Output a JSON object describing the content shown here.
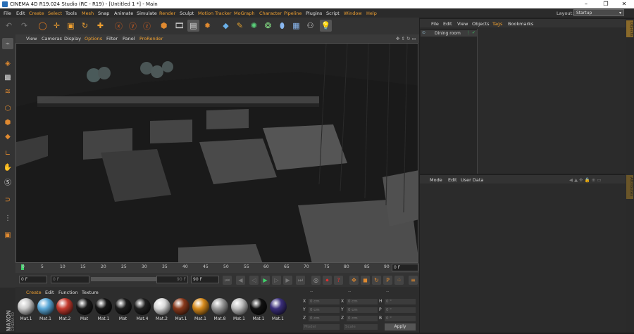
{
  "window": {
    "title": "CINEMA 4D R19.024 Studio (RC - R19) - [Untitled 1 *] - Main",
    "controls": [
      "–",
      "❐",
      "✕"
    ]
  },
  "menu": [
    "File",
    "Edit",
    "Create",
    "Select",
    "Tools",
    "Mesh",
    "Snap",
    "Animate",
    "Simulate",
    "Render",
    "Sculpt",
    "Motion Tracker",
    "MoGraph",
    "Character",
    "Pipeline",
    "Plugins",
    "Script",
    "Window",
    "Help"
  ],
  "layout": {
    "label": "Layout:",
    "value": "Startup"
  },
  "viewport_menu": [
    "View",
    "Cameras",
    "Display",
    "Options",
    "Filter",
    "Panel",
    "ProRender"
  ],
  "timeline": {
    "ticks": [
      "0",
      "5",
      "10",
      "15",
      "20",
      "25",
      "30",
      "35",
      "40",
      "45",
      "50",
      "55",
      "60",
      "65",
      "70",
      "75",
      "80",
      "85",
      "90"
    ],
    "end_frame": "0 F",
    "start_field": "0 F",
    "min_field": "0 F",
    "max_field": "90 F",
    "end_field": "90 F"
  },
  "material_menu": [
    "Create",
    "Edit",
    "Function",
    "Texture"
  ],
  "materials": [
    {
      "name": "Mat.1",
      "color": "#c9c9c9"
    },
    {
      "name": "Mat.1",
      "color": "#5aa8d8"
    },
    {
      "name": "Mat.2",
      "color": "#c43a2e"
    },
    {
      "name": "Mat",
      "color": "#1a1a1a"
    },
    {
      "name": "Mat.1",
      "color": "#151515"
    },
    {
      "name": "Mat",
      "color": "#1c1c1c"
    },
    {
      "name": "Mat.4",
      "color": "#202020"
    },
    {
      "name": "Mat.2",
      "color": "#d8d8d8"
    },
    {
      "name": "Mat.1",
      "color": "#8a3a1c"
    },
    {
      "name": "Mat.1",
      "color": "#d68a1c"
    },
    {
      "name": "Mat.8",
      "color": "#9a9a9a"
    },
    {
      "name": "Mat.1",
      "color": "#bdbdbd"
    },
    {
      "name": "Mat.1",
      "color": "#111111"
    },
    {
      "name": "Mat.1",
      "color": "#3a2e7a"
    }
  ],
  "coords": {
    "header": [
      "--",
      "--",
      "--"
    ],
    "rows": [
      {
        "a": "X",
        "av": "0 cm",
        "b": "X",
        "bv": "0 cm",
        "c": "H",
        "cv": "0 °"
      },
      {
        "a": "Y",
        "av": "0 cm",
        "b": "Y",
        "bv": "0 cm",
        "c": "P",
        "cv": "0 °"
      },
      {
        "a": "Z",
        "av": "0 cm",
        "b": "Z",
        "bv": "0 cm",
        "c": "B",
        "cv": "0 °"
      }
    ],
    "mode": "Model",
    "scale": "Scale",
    "apply": "Apply"
  },
  "objects": {
    "menu": [
      "File",
      "Edit",
      "View",
      "Objects",
      "Tags",
      "Bookmarks"
    ],
    "items": [
      {
        "name": "Dining room"
      }
    ]
  },
  "attributes": {
    "menu": [
      "Mode",
      "Edit",
      "User Data"
    ]
  },
  "side_tabs": [
    "Objects",
    "Attributes"
  ],
  "maxon_logo": "MAXON CINEMA 4D"
}
